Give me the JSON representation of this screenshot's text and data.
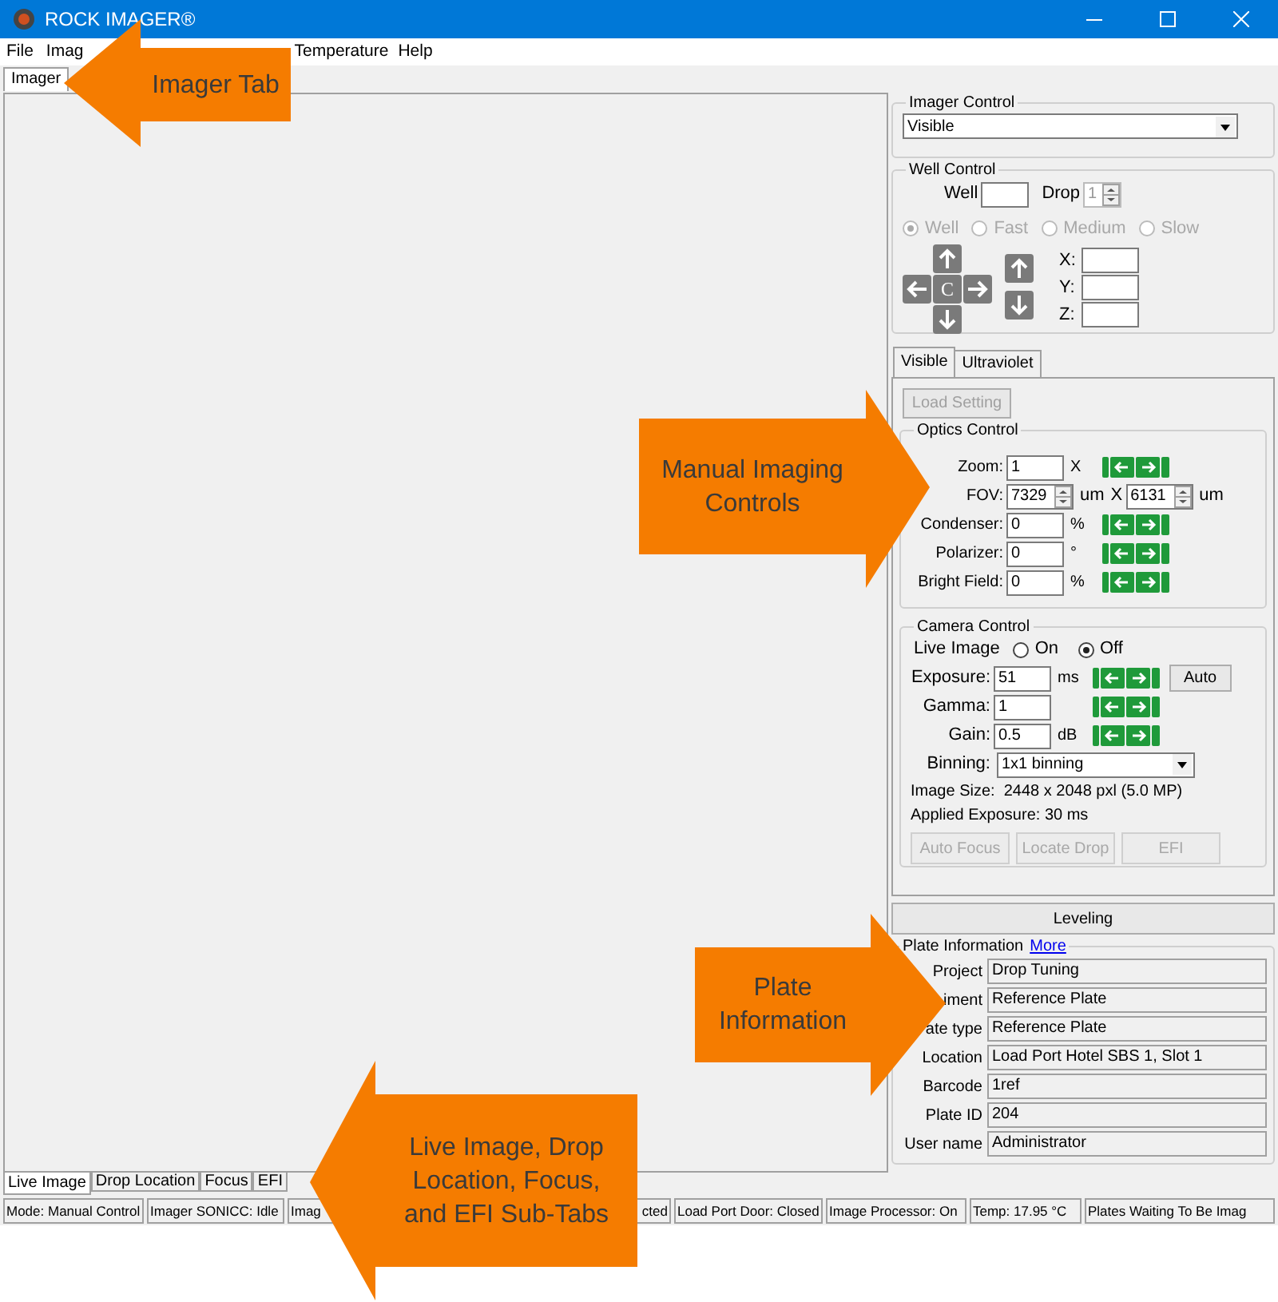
{
  "window": {
    "title": "ROCK IMAGER®"
  },
  "menu": [
    {
      "label": "File"
    },
    {
      "label": "Imag"
    },
    {
      "label": "Temperature"
    },
    {
      "label": "Help"
    }
  ],
  "main_tabs": [
    {
      "label": "Imager",
      "selected": true
    }
  ],
  "imager_control": {
    "title": "Imager Control",
    "mode": "Visible"
  },
  "well_control": {
    "title": "Well Control",
    "well_label": "Well",
    "drop_label": "Drop",
    "drop_value": "1",
    "speeds_disabled": true,
    "speeds": [
      {
        "label": "Well",
        "selected": true
      },
      {
        "label": "Fast",
        "selected": false
      },
      {
        "label": "Medium",
        "selected": false
      },
      {
        "label": "Slow",
        "selected": false
      }
    ],
    "center_label": "C",
    "axes": [
      {
        "label": "X:"
      },
      {
        "label": "Y:"
      },
      {
        "label": "Z:"
      }
    ]
  },
  "settings_tabs": [
    {
      "label": "Visible",
      "selected": true
    },
    {
      "label": "Ultraviolet",
      "selected": false
    }
  ],
  "load_setting": {
    "label": "Load Setting",
    "disabled": true
  },
  "optics": {
    "title": "Optics Control",
    "rows": [
      {
        "kind": "stepper",
        "label": "Zoom:",
        "value": "1",
        "unit": "X"
      },
      {
        "kind": "fov",
        "label": "FOV:",
        "value": "7329",
        "unit": "um",
        "separator": "X",
        "value2": "6131",
        "unit2": "um"
      },
      {
        "kind": "stepper",
        "label": "Condenser:",
        "value": "0",
        "unit": "%"
      },
      {
        "kind": "stepper",
        "label": "Polarizer:",
        "value": "0",
        "unit": "°"
      },
      {
        "kind": "stepper",
        "label": "Bright Field:",
        "value": "0",
        "unit": "%"
      }
    ]
  },
  "camera": {
    "title": "Camera Control",
    "live_label": "Live Image",
    "live_options": [
      {
        "label": "On",
        "selected": false
      },
      {
        "label": "Off",
        "selected": true
      }
    ],
    "rows": [
      {
        "label": "Exposure:",
        "value": "51",
        "unit": "ms",
        "button": "Auto"
      },
      {
        "label": "Gamma:",
        "value": "1"
      },
      {
        "label": "Gain:",
        "value": "0.5",
        "unit": "dB"
      }
    ],
    "binning_label": "Binning:",
    "binning": "1x1 binning",
    "image_size": "Image Size:  2448 x 2048 pxl (5.0 MP)",
    "applied_exposure": "Applied Exposure: 30 ms",
    "buttons": [
      {
        "label": "Auto Focus",
        "disabled": true
      },
      {
        "label": "Locate Drop",
        "disabled": true
      },
      {
        "label": "EFI",
        "disabled": true
      }
    ]
  },
  "leveling": {
    "label": "Leveling"
  },
  "plate_info": {
    "title": "Plate Information",
    "link": "More",
    "fields": [
      {
        "label": "Project",
        "value": "Drop Tuning"
      },
      {
        "label": "iment",
        "value": "Reference Plate"
      },
      {
        "label": "ate type",
        "value": "Reference Plate"
      },
      {
        "label": "Location",
        "value": "Load Port Hotel SBS 1, Slot 1"
      },
      {
        "label": "Barcode",
        "value": "1ref"
      },
      {
        "label": "Plate ID",
        "value": "204"
      },
      {
        "label": "User name",
        "value": "Administrator"
      }
    ]
  },
  "sub_tabs": [
    {
      "label": "Live Image",
      "selected": true
    },
    {
      "label": "Drop Location",
      "selected": false
    },
    {
      "label": "Focus",
      "selected": false
    },
    {
      "label": "EFI",
      "selected": false
    }
  ],
  "status_bar": [
    "Mode: Manual Control",
    "Imager SONICC: Idle",
    "Imag",
    "cted",
    "Load Port Door: Closed",
    "Image Processor: On",
    "Temp: 17.95 °C",
    "Plates Waiting To Be Imag"
  ],
  "callouts": [
    {
      "lines": [
        "Imager Tab"
      ]
    },
    {
      "lines": [
        "Manual Imaging",
        "Controls"
      ]
    },
    {
      "lines": [
        "Plate",
        "Information"
      ]
    },
    {
      "lines": [
        "Live Image, Drop",
        "Location, Focus,",
        "and EFI Sub-Tabs"
      ]
    }
  ]
}
